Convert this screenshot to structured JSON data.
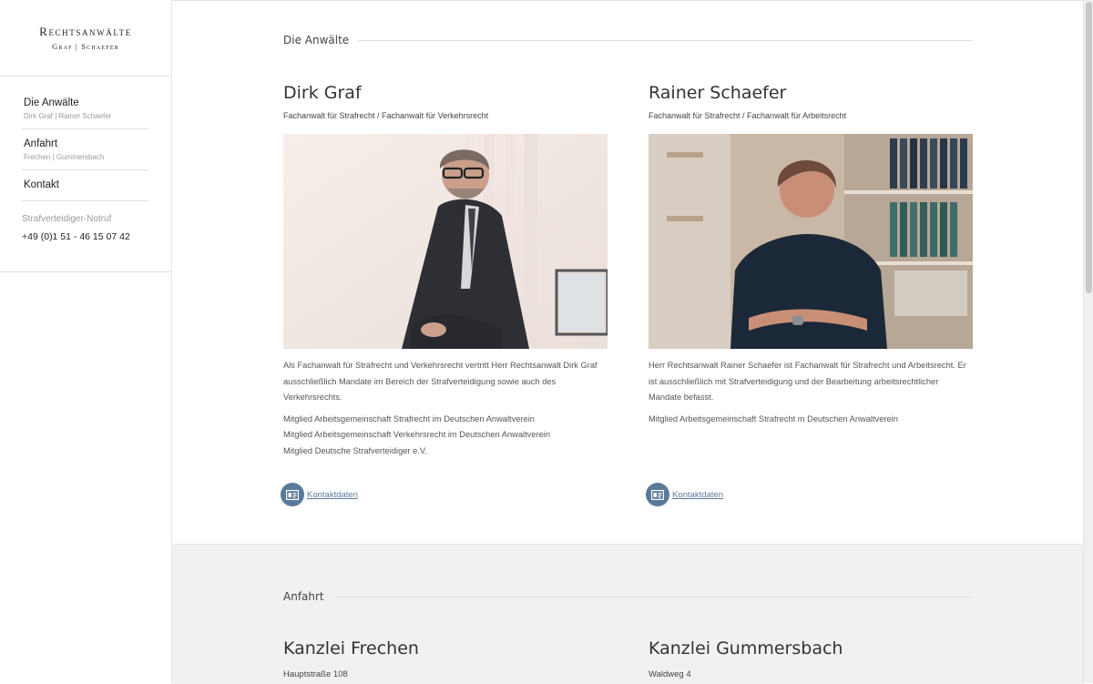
{
  "sidebar": {
    "logo": {
      "line1": "Rechtsanwälte",
      "line2": "Graf | Schaefer"
    },
    "nav": [
      {
        "title": "Die Anwälte",
        "sub": "Dirk Graf | Rainer Schaefer"
      },
      {
        "title": "Anfahrt",
        "sub": "Frechen | Gummersbach"
      },
      {
        "title": "Kontakt",
        "sub": ""
      }
    ],
    "notruf": {
      "label": "Strafverteidiger-Notruf",
      "phone": "+49 (0)1 51 - 46 15 07 42"
    }
  },
  "lawyers": {
    "heading": "Die Anwälte",
    "items": [
      {
        "name": "Dirk Graf",
        "spec": "Fachanwalt für Strafrecht / Fachanwalt für Verkehrsrecht",
        "bio": "Als Fachanwalt für Strafrecht und Verkehrsrecht vertritt Herr Rechtsanwalt Dirk Graf ausschließlich Mandate im Bereich der Strafverteidigung sowie auch des Verkehrsrechts.",
        "memberships": [
          "Mitglied Arbeitsgemeinschaft Strafrecht im Deutschen Anwaltverein",
          "Mitglied Arbeitsgemeinschaft Verkehrsrecht im Deutschen Anwaltverein",
          "Mitglied Deutsche Strafverteidiger e.V."
        ],
        "contact_label": "Kontaktdaten"
      },
      {
        "name": "Rainer Schaefer",
        "spec": "Fachanwalt für Strafrecht / Fachanwalt für Arbeitsrecht",
        "bio": "Herr Rechtsanwalt Rainer Schaefer ist Fachanwalt für Strafrecht und Arbeitsrecht. Er ist ausschließlich mit Strafverteidigung und der Bearbeitung arbeitsrechtlicher Mandate befasst.",
        "memberships": [
          "Mitglied Arbeitsgemeinschaft Strafrecht m Deutschen Anwaltverein"
        ],
        "contact_label": "Kontaktdaten"
      }
    ]
  },
  "directions": {
    "heading": "Anfahrt",
    "offices": [
      {
        "name": "Kanzlei Frechen",
        "street": "Hauptstraße 108"
      },
      {
        "name": "Kanzlei Gummersbach",
        "street": "Waldweg 4"
      }
    ]
  },
  "icons": {
    "contact": "contact-card-icon"
  },
  "colors": {
    "accent": "#5b7a99",
    "section_bg": "#f1f1f1"
  }
}
